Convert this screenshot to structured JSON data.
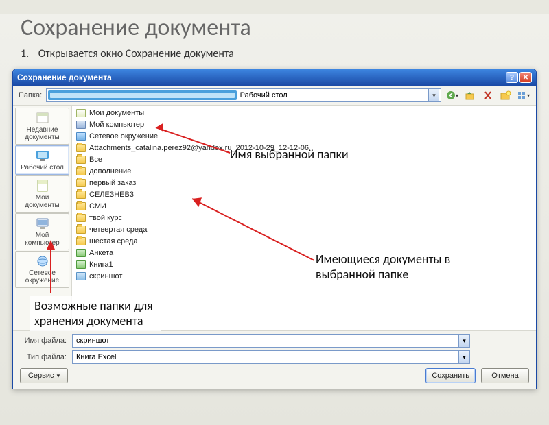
{
  "slide": {
    "title": "Сохранение документа",
    "list_number": "1.",
    "subtitle": "Открывается окно Сохранение документа"
  },
  "annotations": {
    "selected_folder_name": "Имя выбранной папки",
    "existing_docs": "Имеющиеся документы в выбранной папке",
    "possible_folders": "Возможные папки для хранения документа"
  },
  "dialog": {
    "title": "Сохранение документа",
    "folder_label": "Папка:",
    "current_folder": "Рабочий стол",
    "places": [
      {
        "label": "Недавние документы",
        "type": "recent"
      },
      {
        "label": "Рабочий стол",
        "type": "desktop"
      },
      {
        "label": "Мои документы",
        "type": "mydocs"
      },
      {
        "label": "Мой компьютер",
        "type": "computer"
      },
      {
        "label": "Сетевое окружение",
        "type": "network"
      }
    ],
    "files": [
      {
        "name": "Мои документы",
        "icon": "mydocs"
      },
      {
        "name": "Мой компьютер",
        "icon": "mycomp"
      },
      {
        "name": "Сетевое окружение",
        "icon": "net"
      },
      {
        "name": "Attachments_catalina.perez92@yandex.ru_2012-10-29_12-12-06",
        "icon": "folder"
      },
      {
        "name": "Все",
        "icon": "folder"
      },
      {
        "name": "дополнение",
        "icon": "folder"
      },
      {
        "name": "первый заказ",
        "icon": "folder"
      },
      {
        "name": "СЕЛЕЗНЕВ3",
        "icon": "folder"
      },
      {
        "name": "СМИ",
        "icon": "folder"
      },
      {
        "name": "твой курс",
        "icon": "folder"
      },
      {
        "name": "четвертая среда",
        "icon": "folder"
      },
      {
        "name": "шестая среда",
        "icon": "folder"
      },
      {
        "name": "Анкета",
        "icon": "excel"
      },
      {
        "name": "Книга1",
        "icon": "excel"
      },
      {
        "name": "скриншот",
        "icon": "image"
      }
    ],
    "filename_label": "Имя файла:",
    "filename_value": "скриншот",
    "filetype_label": "Тип файла:",
    "filetype_value": "Книга Excel",
    "tools_button": "Сервис",
    "save_button": "Сохранить",
    "cancel_button": "Отмена"
  }
}
